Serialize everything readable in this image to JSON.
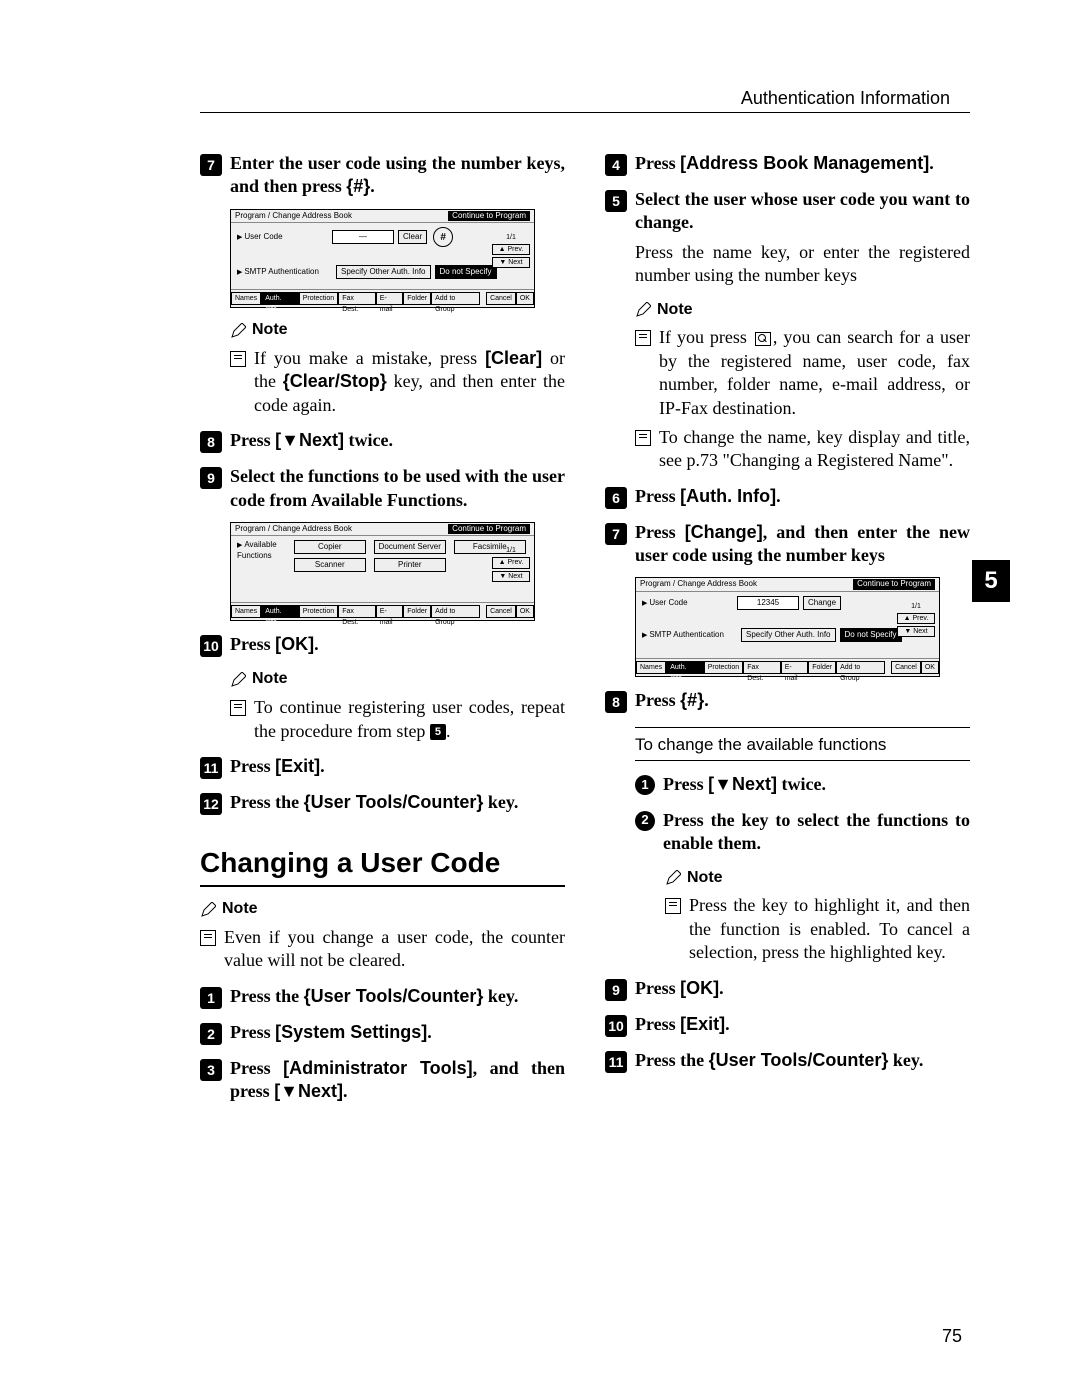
{
  "header": {
    "title": "Authentication Information"
  },
  "chapter_tab": "5",
  "page_number": "75",
  "left": {
    "step7": {
      "part1": "Enter the user code using the number keys, and then press ",
      "hash": "{#}",
      "part2": "."
    },
    "ss1": {
      "title_left": "Program / Change Address Book",
      "title_right": "Continue to Program",
      "user_code_label": "User Code",
      "clear": "Clear",
      "smtp_label": "SMTP Authentication",
      "spec_btn": "Specify Other Auth. Info",
      "donot_btn": "Do not Specify",
      "page_ind": "1/1",
      "prev": "▲ Prev.",
      "next": "▼ Next",
      "tabs": [
        "Names",
        "Auth. Info",
        "Protection",
        "Fax Dest.",
        "E-mail",
        "Folder",
        "Add to Group"
      ],
      "cancel": "Cancel",
      "ok": "OK"
    },
    "note1_label": "Note",
    "note1_body_a": "If you make a mistake, press ",
    "note1_clear": "[Clear]",
    "note1_body_b": " or the ",
    "note1_clearstop": "{Clear/Stop}",
    "note1_body_c": " key, and then enter the code again.",
    "step8": {
      "a": "Press ",
      "b": "[▼Next]",
      "c": " twice."
    },
    "step9": "Select the functions to be used with the user code from Available Functions.",
    "ss2": {
      "title_left": "Program / Change Address Book",
      "title_right": "Continue to Program",
      "avail_label": "Available Functions",
      "funcs": [
        "Copier",
        "Document Server",
        "Facsimile",
        "Scanner",
        "Printer"
      ],
      "page_ind": "1/1",
      "prev": "▲ Prev.",
      "next": "▼ Next",
      "tabs": [
        "Names",
        "Auth. Info",
        "Protection",
        "Fax Dest.",
        "E-mail",
        "Folder",
        "Add to Group"
      ],
      "cancel": "Cancel",
      "ok": "OK"
    },
    "step10": {
      "a": "Press ",
      "b": "[OK]",
      "c": "."
    },
    "note2_label": "Note",
    "note2_body_a": "To continue registering user codes, repeat the procedure from step ",
    "note2_ref": "5",
    "note2_body_b": ".",
    "step11": {
      "a": "Press ",
      "b": "[Exit]",
      "c": "."
    },
    "step12": {
      "a": "Press the ",
      "b": "{User Tools/Counter}",
      "c": " key."
    },
    "section_title": "Changing a User Code",
    "note3_label": "Note",
    "note3_body": "Even if you change a user code, the counter value will not be cleared.",
    "c_step1": {
      "a": "Press the ",
      "b": "{User Tools/Counter}",
      "c": " key."
    },
    "c_step2": {
      "a": "Press ",
      "b": "[System Settings]",
      "c": "."
    },
    "c_step3": {
      "a": "Press ",
      "b": "[Administrator Tools]",
      "c": ", and then press ",
      "d": "[▼Next]",
      "e": "."
    }
  },
  "right": {
    "step4": {
      "a": "Press ",
      "b": "[Address Book Management]",
      "c": "."
    },
    "step5": "Select the user whose user code you want to change.",
    "step5_body": "Press the name key, or enter the registered number using the number keys",
    "noteA_label": "Note",
    "noteA_1a": "If you press ",
    "noteA_1b": ", you can search for a user by the registered name, user code, fax number, folder name, e-mail address, or IP-Fax destination.",
    "noteA_2": "To change the name, key display and title, see p.73 \"Changing a Registered Name\".",
    "step6": {
      "a": "Press ",
      "b": "[Auth. Info]",
      "c": "."
    },
    "step7": {
      "a": "Press ",
      "b": "[Change]",
      "c": ", and then enter the new user code using the number keys"
    },
    "ss3": {
      "title_left": "Program / Change Address Book",
      "title_right": "Continue to Program",
      "user_code_label": "User Code",
      "value": "12345",
      "change": "Change",
      "smtp_label": "SMTP Authentication",
      "spec_btn": "Specify Other Auth. Info",
      "donot_btn": "Do not Specify",
      "page_ind": "1/1",
      "prev": "▲ Prev.",
      "next": "▼ Next",
      "tabs": [
        "Names",
        "Auth. Info",
        "Protection",
        "Fax Dest.",
        "E-mail",
        "Folder",
        "Add to Group"
      ],
      "cancel": "Cancel",
      "ok": "OK"
    },
    "step8": {
      "a": "Press ",
      "b": "{#}",
      "c": "."
    },
    "sub_head": "To change the available functions",
    "s1": {
      "a": "Press ",
      "b": "[▼Next]",
      "c": " twice."
    },
    "s2": "Press the key to select the functions to enable them.",
    "noteB_label": "Note",
    "noteB_body": "Press the key to highlight it, and then the function is enabled. To cancel a selection, press the highlighted key.",
    "step9": {
      "a": "Press ",
      "b": "[OK]",
      "c": "."
    },
    "step10": {
      "a": "Press ",
      "b": "[Exit]",
      "c": "."
    },
    "step11": {
      "a": "Press the ",
      "b": "{User Tools/Counter}",
      "c": " key."
    }
  }
}
